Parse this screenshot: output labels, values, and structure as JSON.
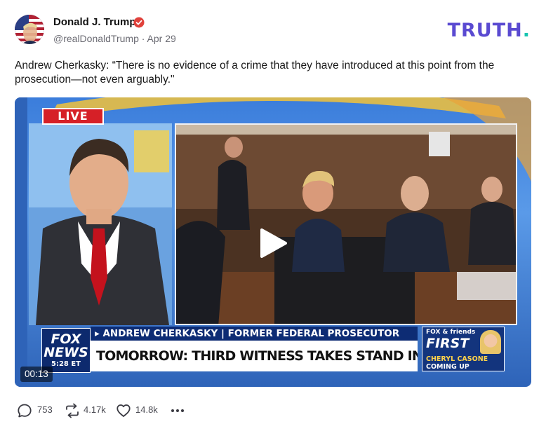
{
  "author": {
    "name": "Donald J. Trump",
    "handle": "@realDonaldTrump",
    "separator": " · ",
    "date": "Apr 29"
  },
  "brand": {
    "logo_text": "TRUTH",
    "logo_dot": "."
  },
  "post": {
    "text": "Andrew Cherkasky: “There is no evidence of a crime that they have introduced at this point from the prosecution—not even arguably.\""
  },
  "video": {
    "live_label": "LIVE",
    "timestamp": "00:13",
    "network_logo_line1": "FOX",
    "network_logo_line2": "NEWS",
    "network_logo_clock": "5:28 ET",
    "name_bar": "▸ ANDREW CHERKASKY | FORMER FEDERAL PROSECUTOR",
    "headline": "TOMORROW: THIRD WITNESS TAKES STAND IN NY V. TRUMP",
    "promo_tag": "FOX & friends",
    "promo_show": "FIRST",
    "promo_host": "CHERYL CASONE",
    "promo_status": "COMING UP"
  },
  "actions": {
    "replies": "753",
    "retruths": "4.17k",
    "likes": "14.8k",
    "more_icon": "ellipsis-icon"
  },
  "colors": {
    "brand_purple": "#5a4ad1",
    "brand_teal": "#18c4b0",
    "verified_red": "#e0413b",
    "live_red": "#d62027",
    "fox_blue": "#0d2c74"
  }
}
